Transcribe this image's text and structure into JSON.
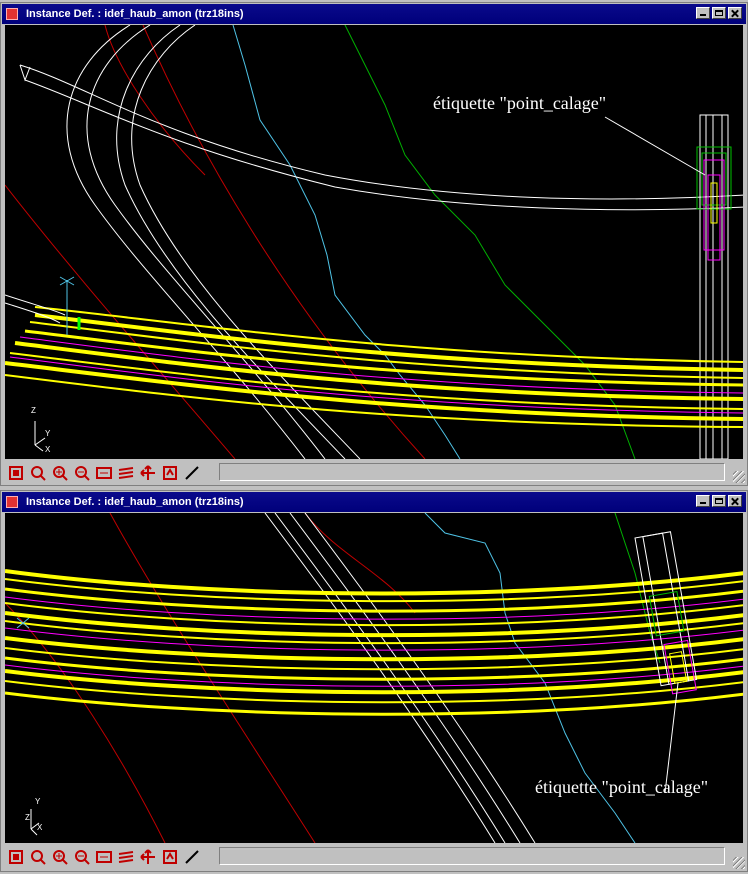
{
  "windows": [
    {
      "title": "Instance Def. : idef_haub_amon (trz18ins)",
      "annotation": "étiquette \"point_calage\"",
      "status_text": ""
    },
    {
      "title": "Instance Def. : idef_haub_amon (trz18ins)",
      "annotation": "étiquette \"point_calage\"",
      "status_text": ""
    }
  ],
  "axis": {
    "z": "Z",
    "y": "Y",
    "x": "X"
  },
  "toolbar_icons": [
    "view-fit-icon",
    "zoom-window-icon",
    "zoom-in-icon",
    "zoom-out-icon",
    "view-frame-icon",
    "layers-icon",
    "pan-icon",
    "zoom-previous-icon",
    "measure-line-icon"
  ],
  "colors": {
    "titlebar": "#00007a",
    "canvas": "#000000",
    "road": "#ffff00",
    "profile": "#ff00ff",
    "contour_red": "#c00000",
    "contour_cyan": "#4fc3e6",
    "contour_green": "#00b000",
    "linework": "#ffffff"
  }
}
